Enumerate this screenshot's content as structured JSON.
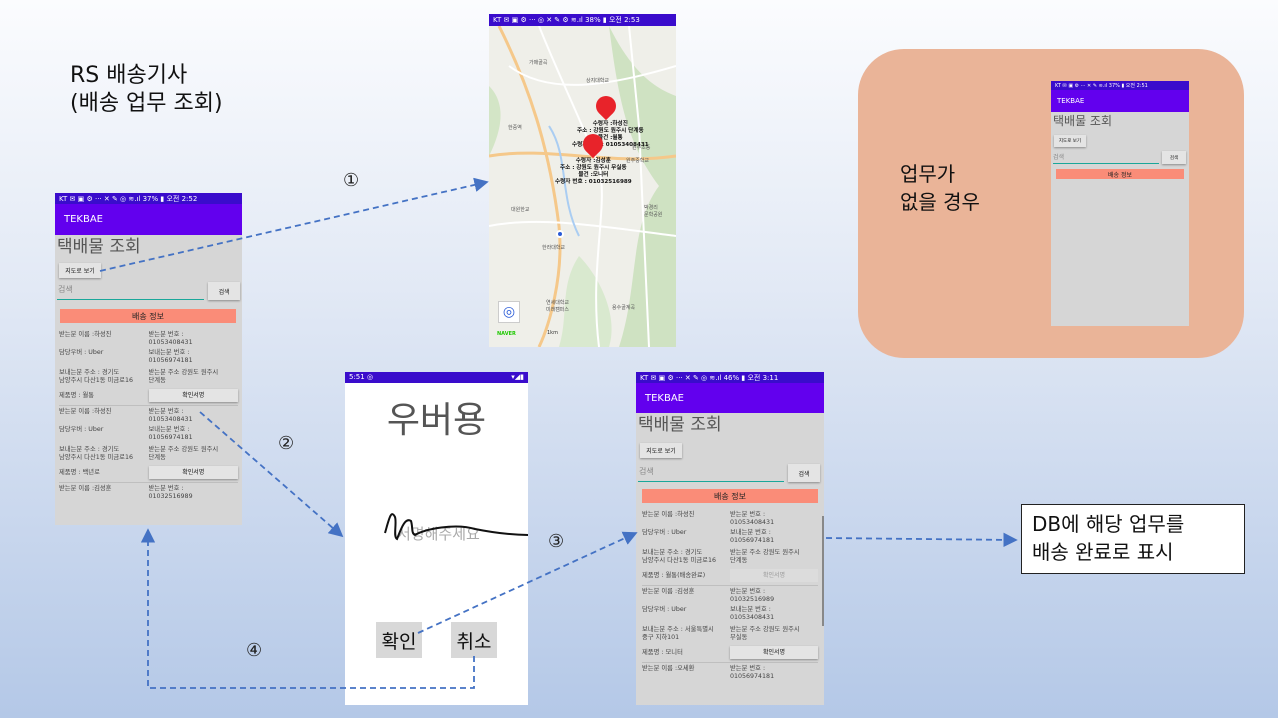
{
  "title": {
    "line1": "RS 배송기사",
    "line2": "(배송 업무 조회)"
  },
  "steps": {
    "one": "①",
    "two": "②",
    "three": "③",
    "four": "④"
  },
  "no_task_label": {
    "line1": "업무가",
    "line2": "없을 경우"
  },
  "db_box": {
    "line1": "DB에 해당 업무를",
    "line2": "배송 완료로 표시"
  },
  "colors": {
    "app_bar": "#6200ee",
    "status_bar": "#3a0ccc",
    "delivery_header": "#fa8c78",
    "peach_panel": "#eab498",
    "marker": "#e8232a",
    "arrow": "#4472c4"
  },
  "phone_left": {
    "status": "KT ✉ ▣ ⚙ ···    ✕ ✎ ◎ ≋.ıl 37% ▮ 오전 2:52",
    "app_title": "TEKBAE",
    "heading": "택배물 조회",
    "map_button": "지도로 보기",
    "search_placeholder": "검색",
    "search_button": "검색",
    "delivery_header": "배송 정보",
    "items": [
      {
        "receiver": "받는분 이름 :하성진",
        "receiver_phone": "받는분 번호 :\n01053408431",
        "driver": "담당우버 : Uber",
        "sender_phone": "보내는분 번호 :\n01056974181",
        "sender_addr": "보내는분 주소 : 경기도\n남양주시 다산1동 미금로16",
        "receiver_addr": "받는분 주소 강원도 원주시\n단계동",
        "product": "제품명 : 월통",
        "confirm": "확인서명"
      },
      {
        "receiver": "받는분 이름 :하성진",
        "receiver_phone": "받는분 번호 :\n01053408431",
        "driver": "담당우버 : Uber",
        "sender_phone": "보내는분 번호 :\n01056974181",
        "sender_addr": "보내는분 주소 : 경기도\n남양주시 다산1동 미금로16",
        "receiver_addr": "받는분 주소 강원도 원주시\n단계동",
        "product": "제품명 : 백년로",
        "confirm": "확인서명"
      }
    ],
    "last_receiver": "받는분 이름 :김성훈",
    "last_phone": "받는분 번호 :\n01032516989"
  },
  "map": {
    "status": "KT ✉ ▣ ⚙ ···    ◎ ✕ ✎ ⚙ ≋.ıl 38% ▮ 오전 2:53",
    "places": [
      "가매골곡",
      "상지대학교",
      "한중역",
      "원주초등",
      "원주중학교",
      "대원한교",
      "한라대학교",
      "연세대학교\n미래캠퍼스",
      "용수골계곡",
      "박경리\n문학공원"
    ],
    "marker1": "수령자 :하성진\n주소 : 강원도 원주시 단계동\n물건 :월통\n수령자 번호 : 01053408431",
    "marker2": "수령자 :김성훈\n주소 : 강원도 원주시 무실동\n물건 :모니터\n수령자 번호 : 01032516989",
    "naver": "NAVER",
    "scale": "1km"
  },
  "sign_screen": {
    "status": "5:51  ◎",
    "status_right": "▾◢▮",
    "title": "우버용",
    "placeholder": "서명해주세요",
    "confirm": "확인",
    "cancel": "취소"
  },
  "phone_right": {
    "status": "KT ✉ ▣ ⚙ ···    ✕ ✎ ◎ ≋.ıl 46% ▮ 오전 3:11",
    "app_title": "TEKBAE",
    "heading": "택배물 조회",
    "map_button": "지도로 보기",
    "search_placeholder": "검색",
    "search_button": "검색",
    "delivery_header": "배송 정보",
    "items": [
      {
        "receiver": "받는분 이름 :하성진",
        "receiver_phone": "받는분 번호 :\n01053408431",
        "driver": "담당우버 : Uber",
        "sender_phone": "보내는분 번호 :\n01056974181",
        "sender_addr": "보내는분 주소 : 경기도\n남양주시 다산1동 미금로16",
        "receiver_addr": "받는분 주소 강원도 원주시\n단계동",
        "product": "제품명 : 월통(배송완료)",
        "confirm": "확인서명"
      },
      {
        "receiver": "받는분 이름 :김성훈",
        "receiver_phone": "받는분 번호 :\n01032516989",
        "driver": "담당우버 : Uber",
        "sender_phone": "보내는분 번호 :\n01053408431",
        "sender_addr": "보내는분 주소 : 서울특별시\n중구 지하101",
        "receiver_addr": "받는분 주소 강원도 원주시\n무실동",
        "product": "제품명 : 모니터",
        "confirm": "확인서명"
      }
    ],
    "last_receiver": "받는분 이름 :오세환",
    "last_phone": "받는분 번호 :\n01056974181"
  },
  "phone_small": {
    "status": "KT ✉ ▣ ⚙ ···   ✕ ✎ ≋.ıl 37% ▮ 오전 2:51",
    "app_title": "TEKBAE",
    "heading": "택배물 조회",
    "map_button": "지도로 보기",
    "search_placeholder": "검색",
    "search_button": "검색",
    "delivery_header": "배송 정보"
  }
}
